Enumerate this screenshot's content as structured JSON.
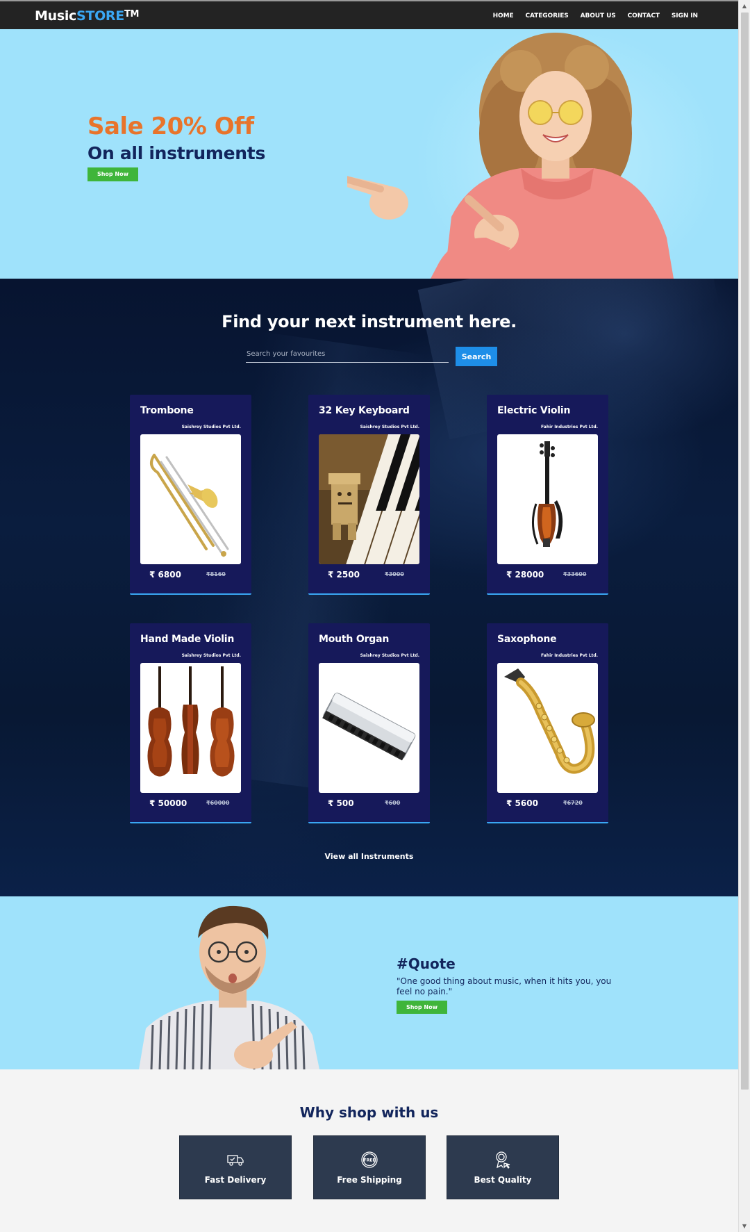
{
  "nav": {
    "brand_main": "Music",
    "brand_accent": "STORE",
    "brand_tm": "TM",
    "items": [
      "HOME",
      "CATEGORIES",
      "ABOUT US",
      "CONTACT",
      "SIGN IN"
    ]
  },
  "hero": {
    "title": "Sale 20% Off",
    "subtitle": "On all instruments",
    "cta": "Shop Now"
  },
  "search": {
    "heading": "Find your next instrument here.",
    "placeholder": "Search your favourites",
    "button": "Search"
  },
  "products": [
    {
      "name": "Trombone",
      "vendor": "Saishrey Studios Pvt Ltd.",
      "price": "₹ 6800",
      "old_price": "₹8160",
      "image": "trombone"
    },
    {
      "name": "32 Key Keyboard",
      "vendor": "Saishrey Studios Pvt Ltd.",
      "price": "₹ 2500",
      "old_price": "₹3000",
      "image": "keyboard"
    },
    {
      "name": "Electric Violin",
      "vendor": "Fahir Industries Pvt Ltd.",
      "price": "₹ 28000",
      "old_price": "₹33600",
      "image": "electric-violin"
    },
    {
      "name": "Hand Made Violin",
      "vendor": "Saishrey Studios Pvt Ltd.",
      "price": "₹ 50000",
      "old_price": "₹60000",
      "image": "violins"
    },
    {
      "name": "Mouth Organ",
      "vendor": "Saishrey Studios Pvt Ltd.",
      "price": "₹ 500",
      "old_price": "₹600",
      "image": "harmonica"
    },
    {
      "name": "Saxophone",
      "vendor": "Fahir Industries Pvt Ltd.",
      "price": "₹ 5600",
      "old_price": "₹6720",
      "image": "saxophone"
    }
  ],
  "view_all": "View all Instruments",
  "quote": {
    "title": "#Quote",
    "text": "\"One good thing about music, when it hits you, you feel no pain.\"",
    "cta": "Shop Now"
  },
  "why": {
    "title": "Why shop with us",
    "features": [
      {
        "label": "Fast Delivery",
        "icon": "truck-icon"
      },
      {
        "label": "Free Shipping",
        "icon": "free-badge-icon"
      },
      {
        "label": "Best Quality",
        "icon": "award-icon"
      }
    ]
  },
  "colors": {
    "nav_bg": "#232323",
    "brand_accent": "#3aa7f3",
    "hero_bg": "#9fe2fb",
    "sale_orange": "#e8742b",
    "navy": "#12255c",
    "green_button": "#3fb53a",
    "card_bg": "#16195a",
    "search_button": "#1e8ee8",
    "feature_bg": "#2d3a4f"
  }
}
